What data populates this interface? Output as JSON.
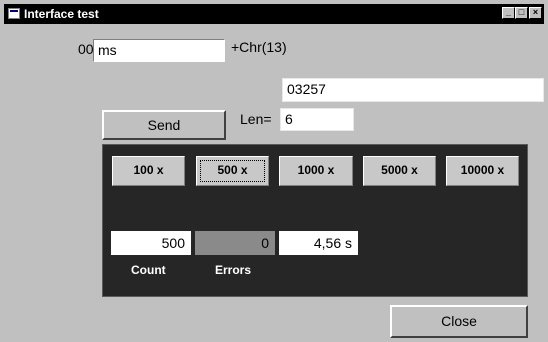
{
  "window": {
    "title": "Interface test"
  },
  "form": {
    "prefix_label": "00",
    "command_value": "ms",
    "suffix_label": "+Chr(13)",
    "response_value": "03257",
    "send_label": "Send",
    "len_label": "Len=",
    "len_value": "6",
    "close_label": "Close"
  },
  "panel": {
    "buttons": [
      "100 x",
      "500 x",
      "1000 x",
      "5000 x",
      "10000 x"
    ],
    "active_button": "500 x",
    "count_value": "500",
    "errors_value": "0",
    "time_value": "4,56 s",
    "count_label": "Count",
    "errors_label": "Errors"
  },
  "colors": {
    "window_bg": "#c0c0c0",
    "titlebar_bg": "#000000",
    "panel_bg": "#262626"
  }
}
